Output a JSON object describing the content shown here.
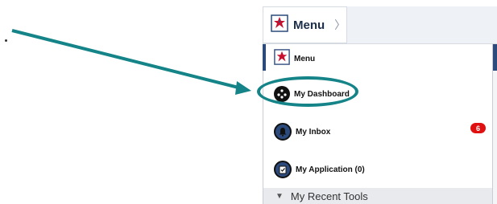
{
  "header": {
    "menu_label": "Menu",
    "chevron": "〉"
  },
  "menu": {
    "items": [
      {
        "label": "Menu",
        "icon": "bsa-emblem-icon"
      },
      {
        "label": "My Dashboard",
        "icon": "dashboard-icon"
      },
      {
        "label": "My Inbox",
        "icon": "bell-icon"
      },
      {
        "label": "My Application (0)",
        "icon": "clipboard-icon"
      }
    ],
    "inbox_badge": "6",
    "recent_tools": "My Recent Tools"
  },
  "colors": {
    "annotation": "#148488",
    "navy": "#2c4a7c",
    "badge": "#e01010"
  }
}
